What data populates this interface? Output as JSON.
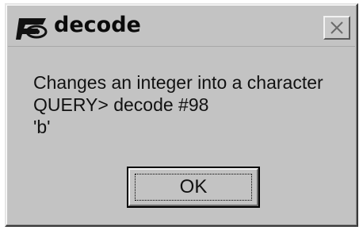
{
  "window": {
    "title": "decode",
    "icon": "app-logo-icon",
    "close_icon": "close-icon"
  },
  "message": {
    "lines": [
      "Changes an integer into a character",
      "QUERY> decode #98",
      "'b'"
    ]
  },
  "buttons": {
    "ok_label": "OK"
  },
  "colors": {
    "dialog_background": "#c3c3c3",
    "text": "#111111"
  }
}
